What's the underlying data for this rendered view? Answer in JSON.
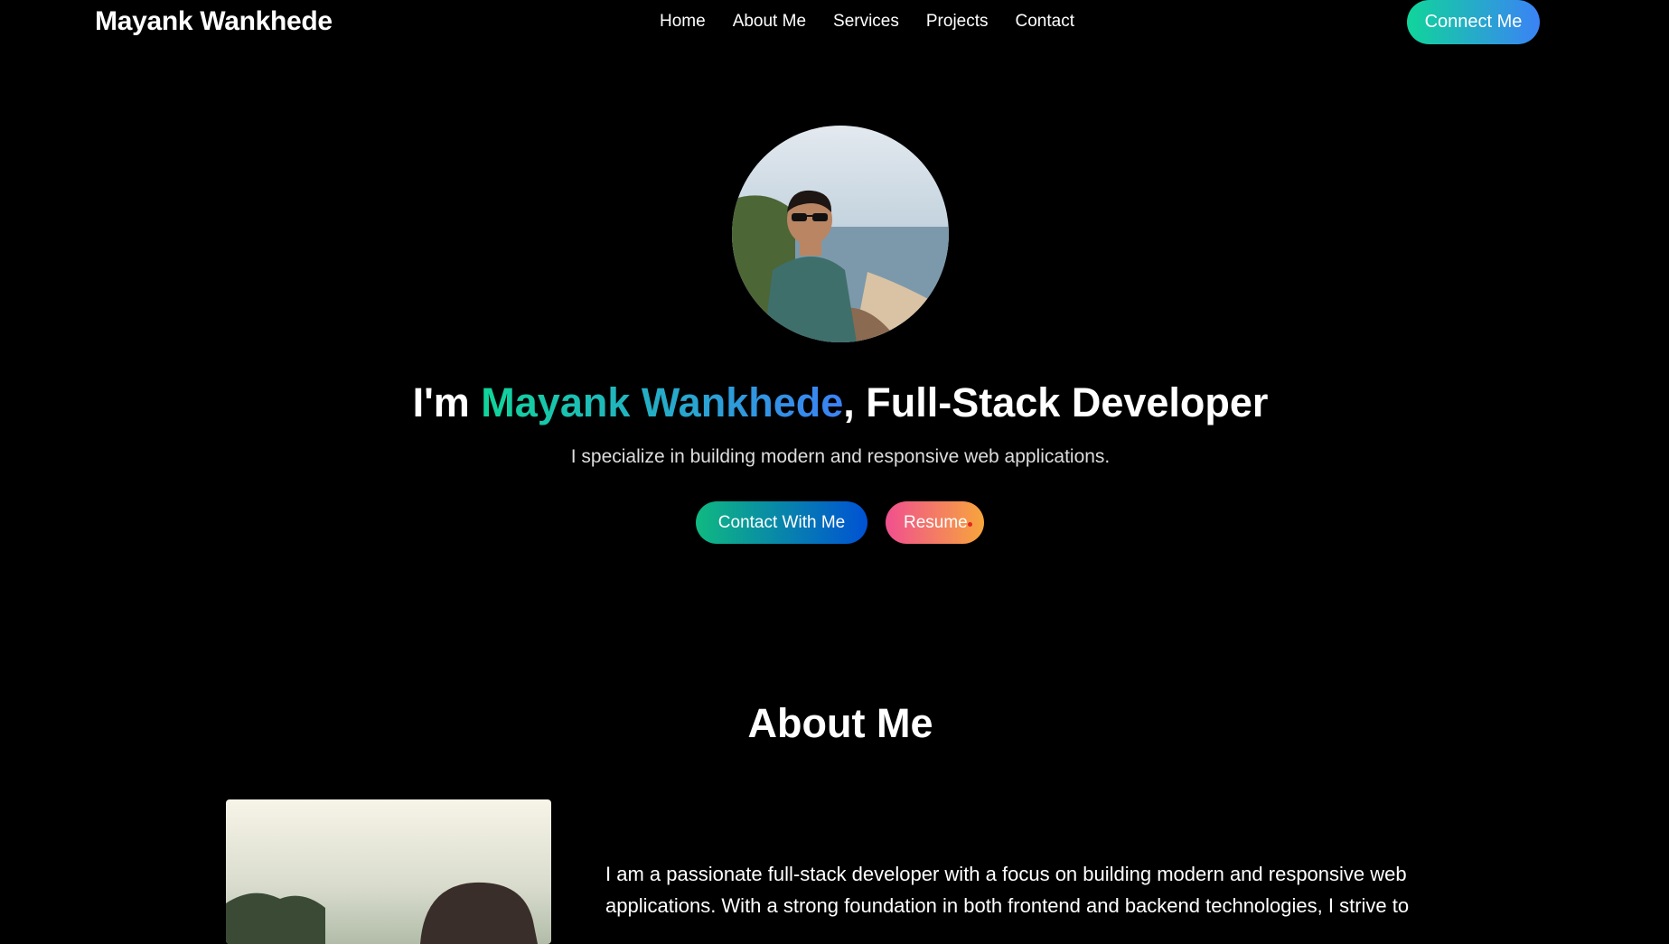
{
  "nav": {
    "brand": "Mayank Wankhede",
    "links": [
      "Home",
      "About Me",
      "Services",
      "Projects",
      "Contact"
    ],
    "cta": "Connect Me"
  },
  "hero": {
    "headline_prefix": "I'm ",
    "headline_name": "Mayank Wankhede",
    "headline_suffix": ", Full-Stack Developer",
    "tagline": "I specialize in building modern and responsive web applications.",
    "buttons": {
      "contact": "Contact With Me",
      "resume": "Resume"
    }
  },
  "about": {
    "title": "About Me",
    "text": "I am a passionate full-stack developer with a focus on building modern and responsive web applications. With a strong foundation in both frontend and backend technologies, I strive to"
  },
  "colors": {
    "background": "#000000",
    "accent_start": "#10d59a",
    "accent_end": "#3b82f6",
    "resume_start": "#f0508f",
    "resume_end": "#f7a53c"
  }
}
